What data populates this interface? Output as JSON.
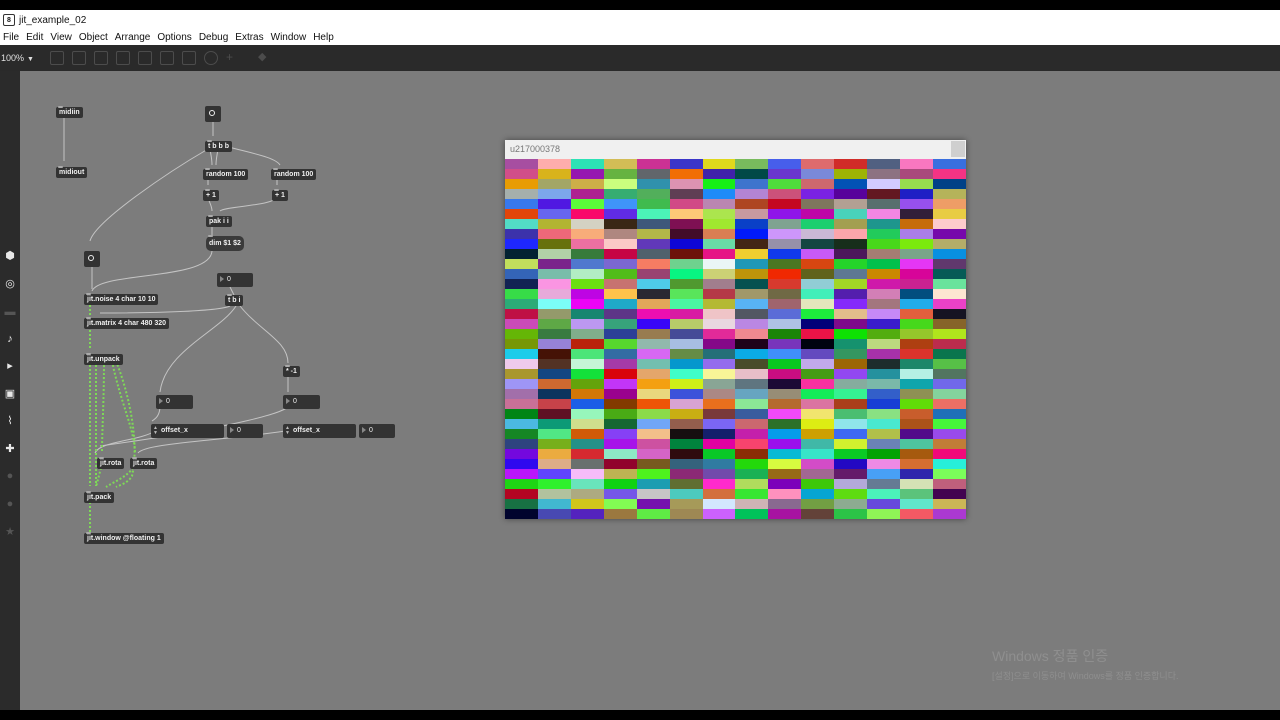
{
  "window": {
    "title": "jit_example_02"
  },
  "menu": [
    "File",
    "Edit",
    "View",
    "Object",
    "Arrange",
    "Options",
    "Debug",
    "Extras",
    "Window",
    "Help"
  ],
  "toolbar": {
    "zoom": "100%"
  },
  "patch": {
    "midiin": "midiin",
    "midiout": "midiout",
    "tbbb": "t b b b",
    "random1": "random 100",
    "random2": "random 100",
    "plus1a": "+ 1",
    "plus1b": "+ 1",
    "pak": "pak i i",
    "dim": "dim $1 $2",
    "noise": "jit.noise 4 char 10 10",
    "matrix": "jit.matrix 4 char 480 320",
    "unpack": "jit.unpack",
    "tbi": "t b i",
    "mul": "* -1",
    "num_top": "0",
    "num_left": "0",
    "num_right": "0",
    "offset_label": "offset_x",
    "offset_val": "0",
    "rota1": "jit.rota",
    "rota2": "jit.rota",
    "pack": "jit.pack",
    "window": "jit.window @floating 1"
  },
  "jit_window": {
    "title": "u217000378"
  },
  "watermark": {
    "line1": "Windows 정품 인증",
    "line2": "[설정]으로 이동하여 Windows를 정품 인증합니다."
  }
}
